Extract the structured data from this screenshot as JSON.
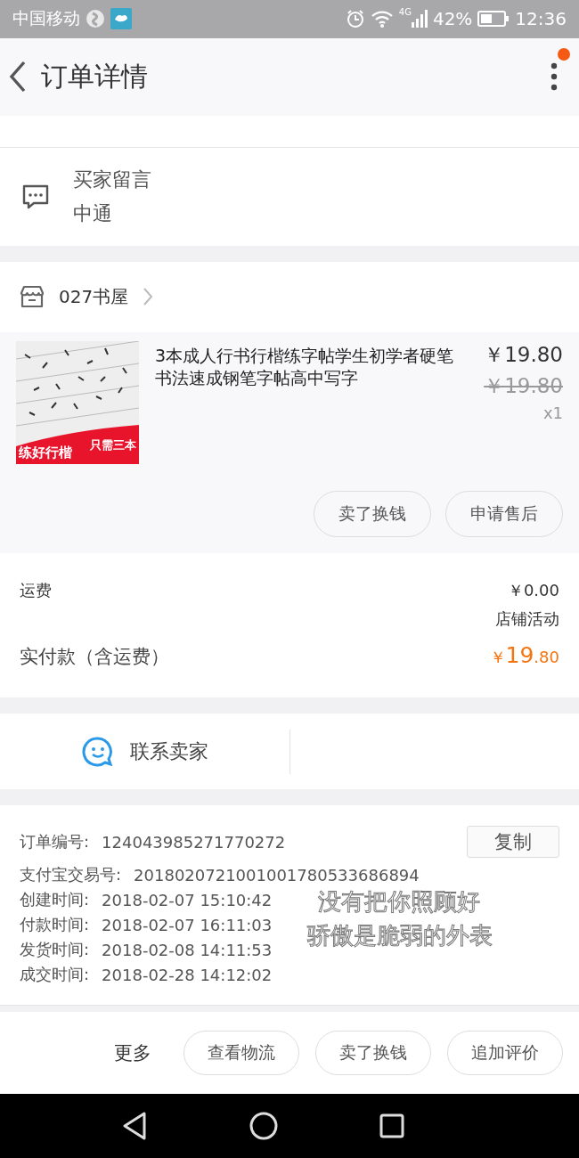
{
  "status_bar": {
    "carrier": "中国移动",
    "network": "4G",
    "battery": "42%",
    "time": "12:36"
  },
  "header": {
    "title": "订单详情",
    "has_notification": true
  },
  "buyer_message": {
    "label": "买家留言",
    "text": "中通"
  },
  "shop": {
    "name": "027书屋"
  },
  "item": {
    "image": {
      "kind": "picture",
      "banner_left": "练好行楷",
      "banner_right": "只需三本"
    },
    "title": "3本成人行书行楷练字帖学生初学者硬笔书法速成钢笔字帖高中写字",
    "price": "￥19.80",
    "original_price": "￥19.80",
    "quantity": "x1",
    "buttons": [
      "卖了换钱",
      "申请售后"
    ]
  },
  "totals": {
    "shipping_label": "运费",
    "shipping_value": "￥0.00",
    "promo": "店铺活动",
    "paid_label": "实付款（含运费）",
    "paid_currency": "￥",
    "paid_integer": "19",
    "paid_decimal": ".80"
  },
  "contact": {
    "label": "联系卖家"
  },
  "info": {
    "order_no_label": "订单编号:",
    "order_no": "124043985271770272",
    "copy_button": "复制",
    "rows": [
      {
        "label": "支付宝交易号:",
        "value": "2018020721001001780533686894"
      },
      {
        "label": "创建时间:",
        "value": "2018-02-07 15:10:42"
      },
      {
        "label": "付款时间:",
        "value": "2018-02-07 16:11:03"
      },
      {
        "label": "发货时间:",
        "value": "2018-02-08 14:11:53"
      },
      {
        "label": "成交时间:",
        "value": "2018-02-28 14:12:02"
      }
    ]
  },
  "floating_lyrics": [
    "没有把你照顾好",
    "骄傲是脆弱的外表"
  ],
  "bottom_bar": {
    "more": "更多",
    "buttons": [
      "查看物流",
      "卖了换钱",
      "追加评价"
    ]
  }
}
